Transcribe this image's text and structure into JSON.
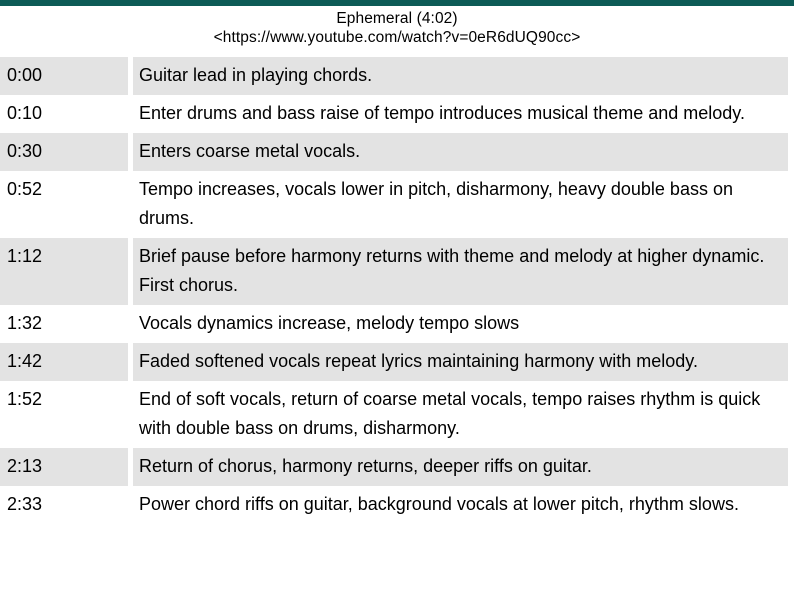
{
  "slide": {
    "accent_color": "#0d5b56",
    "shaded_row_color": "#e3e3e3",
    "plain_row_color": "#ffffff",
    "text_color": "#000000"
  },
  "header": {
    "title": "Ephemeral (4:02)",
    "source_url": "<https://www.youtube.com/watch?v=0eR6dUQ90cc>"
  },
  "cue_table": {
    "rows": [
      {
        "time": "0:00",
        "description": "Guitar lead in playing chords.",
        "shaded": true
      },
      {
        "time": "0:10",
        "description": "Enter drums and bass raise of tempo introduces musical theme and melody.",
        "shaded": false
      },
      {
        "time": "0:30",
        "description": "Enters coarse metal vocals.",
        "shaded": true
      },
      {
        "time": "0:52",
        "description": "Tempo increases, vocals lower in pitch, disharmony, heavy double bass on drums.",
        "shaded": false
      },
      {
        "time": "1:12",
        "description": "Brief pause before harmony returns with theme and melody at higher dynamic. First chorus.",
        "shaded": true
      },
      {
        "time": "1:32",
        "description": "Vocals dynamics increase, melody tempo slows",
        "shaded": false
      },
      {
        "time": "1:42",
        "description": "Faded softened vocals repeat lyrics maintaining harmony with melody.",
        "shaded": true
      },
      {
        "time": "1:52",
        "description": "End of soft vocals, return of coarse metal vocals, tempo raises rhythm is quick with double bass on drums, disharmony.",
        "shaded": false
      },
      {
        "time": "2:13",
        "description": "Return of chorus, harmony returns, deeper riffs on guitar.",
        "shaded": true
      },
      {
        "time": "2:33",
        "description": "Power chord riffs on guitar, background vocals at lower pitch, rhythm slows.",
        "shaded": false
      }
    ]
  }
}
